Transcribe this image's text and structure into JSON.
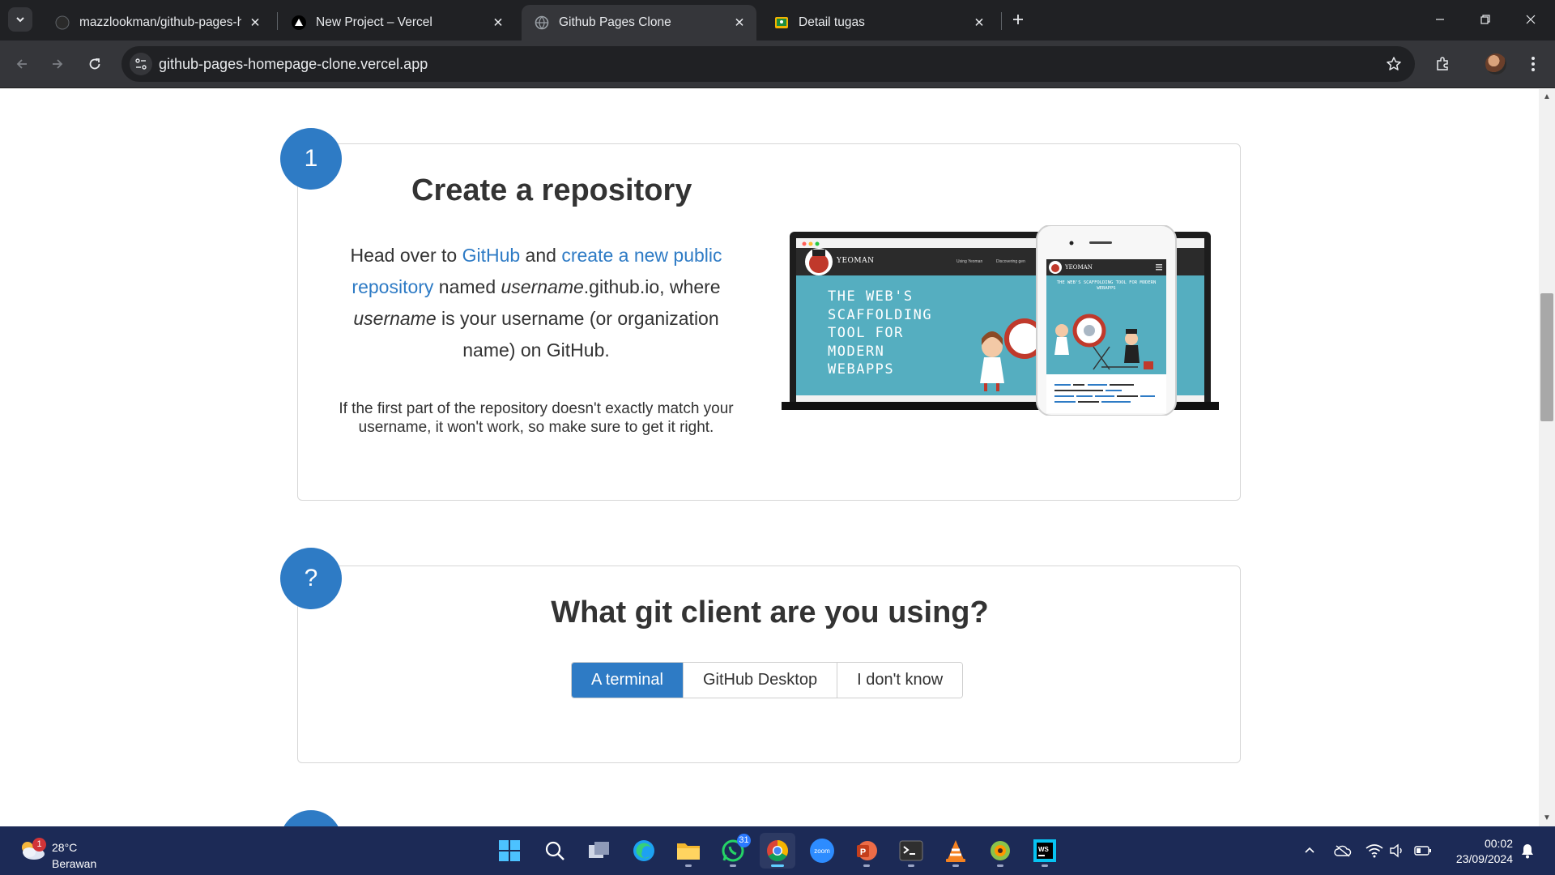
{
  "browser": {
    "tabs": [
      {
        "title": "mazzlookman/github-pages-hc",
        "icon": "github-icon",
        "active": false
      },
      {
        "title": "New Project – Vercel",
        "icon": "vercel-icon",
        "active": false
      },
      {
        "title": "Github Pages Clone",
        "icon": "globe-icon",
        "active": true
      },
      {
        "title": "Detail tugas",
        "icon": "classroom-icon",
        "active": false
      }
    ],
    "url": "github-pages-homepage-clone.vercel.app"
  },
  "page": {
    "step1": {
      "number": "1",
      "title": "Create a repository",
      "text_head": "Head over to ",
      "link_github": "GitHub",
      "text_and": " and ",
      "link_create": "create a new public repository",
      "text_named": " named ",
      "username_em": "username",
      "text_github_io": ".github.io, where ",
      "username_em2": "username",
      "text_rest": " is your username (or organization name) on GitHub.",
      "note": "If the first part of the repository doesn't exactly match your username, it won't work, so make sure to get it right.",
      "illustration": {
        "brand": "YEOMAN",
        "headline_lines": [
          "THE WEB'S",
          "SCAFFOLDING",
          "TOOL FOR",
          "MODERN",
          "WEBAPPS"
        ],
        "nav_items": [
          "Using Yeoman",
          "Discovering gen"
        ],
        "phone_headline": "THE WEB'S SCAFFOLDING TOOL FOR MODERN WEBAPPS"
      }
    },
    "step2": {
      "number": "?",
      "title": "What git client are you using?",
      "options": [
        "A terminal",
        "GitHub Desktop",
        "I don't know"
      ],
      "selected": "A terminal"
    }
  },
  "taskbar": {
    "weather_temp": "28°C",
    "weather_cond": "Berawan",
    "weather_badge": "1",
    "whatsapp_badge": "31",
    "zoom_label": "zoom",
    "time": "00:02",
    "date": "23/09/2024"
  },
  "colors": {
    "accent": "#2e7bc5",
    "chrome_dark": "#202124",
    "taskbar": "#1c2a56",
    "yeoman_teal": "#55aec0"
  }
}
